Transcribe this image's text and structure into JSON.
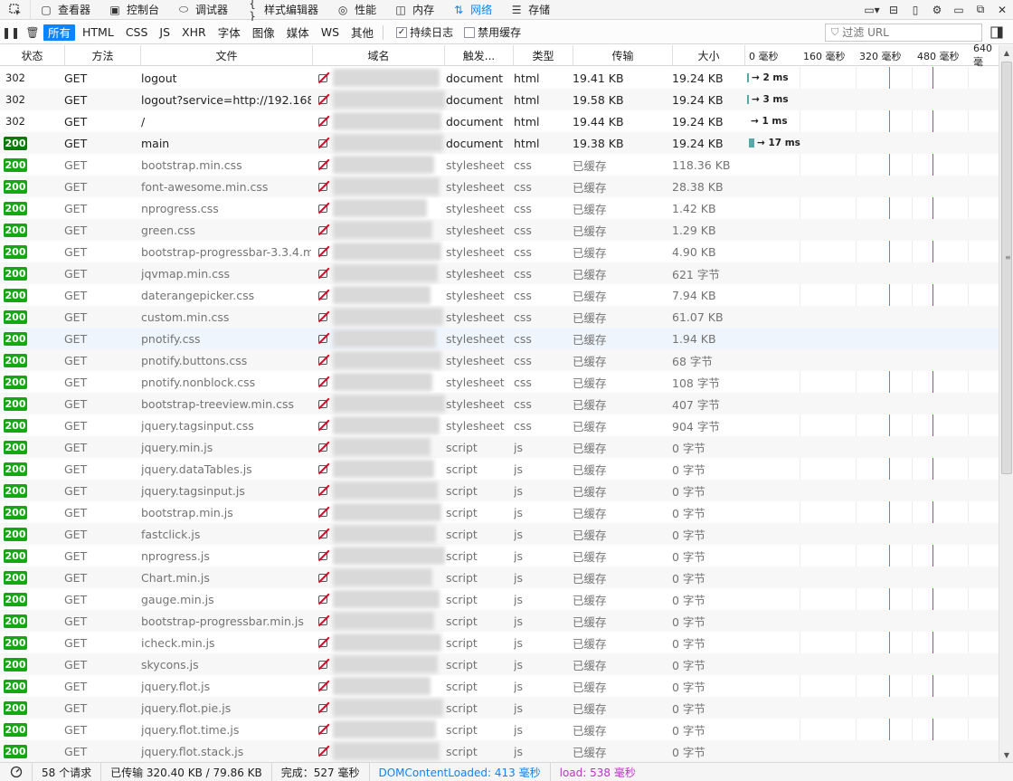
{
  "toolbar": {
    "tabs": [
      {
        "icon": "inspector-icon",
        "glyph": "▢",
        "label": "查看器"
      },
      {
        "icon": "console-icon",
        "glyph": "▣",
        "label": "控制台"
      },
      {
        "icon": "debugger-icon",
        "glyph": "⬭",
        "label": "调试器"
      },
      {
        "icon": "style-editor-icon",
        "glyph": "{ }",
        "label": "样式编辑器"
      },
      {
        "icon": "performance-icon",
        "glyph": "◎",
        "label": "性能"
      },
      {
        "icon": "memory-icon",
        "glyph": "◫",
        "label": "内存"
      },
      {
        "icon": "network-icon",
        "glyph": "⇅",
        "label": "网络"
      },
      {
        "icon": "storage-icon",
        "glyph": "☰",
        "label": "存储"
      }
    ],
    "active_tab": "网络"
  },
  "filters": {
    "types": [
      "所有",
      "HTML",
      "CSS",
      "JS",
      "XHR",
      "字体",
      "图像",
      "媒体",
      "WS",
      "其他"
    ],
    "active_type": "所有",
    "persist_logs_label": "持续日志",
    "persist_logs_checked": true,
    "disable_cache_label": "禁用缓存",
    "disable_cache_checked": false,
    "url_filter_placeholder": "过滤 URL"
  },
  "columns": {
    "status": "状态",
    "method": "方法",
    "file": "文件",
    "domain": "域名",
    "cause": "触发...",
    "type": "类型",
    "transferred": "传输",
    "size": "大小",
    "waterfall_ticks": [
      "0 毫秒",
      "160 毫秒",
      "320 毫秒",
      "480 毫秒",
      "640 毫"
    ]
  },
  "requests": [
    {
      "status": "302",
      "method": "GET",
      "file": "logout",
      "cause": "document",
      "type": "html",
      "transferred": "19.41 KB",
      "size": "19.24 KB",
      "timing": "→ 2 ms",
      "cached": false
    },
    {
      "status": "302",
      "method": "GET",
      "file": "logout?service=http://192.168....",
      "cause": "document",
      "type": "html",
      "transferred": "19.58 KB",
      "size": "19.24 KB",
      "timing": "→ 3 ms",
      "cached": false
    },
    {
      "status": "302",
      "method": "GET",
      "file": "/",
      "cause": "document",
      "type": "html",
      "transferred": "19.44 KB",
      "size": "19.24 KB",
      "timing": "→ 1 ms",
      "cached": false
    },
    {
      "status": "200",
      "method": "GET",
      "file": "main",
      "cause": "document",
      "type": "html",
      "transferred": "19.38 KB",
      "size": "19.24 KB",
      "timing": "→ 17 ms",
      "cached": false
    },
    {
      "status": "200",
      "method": "GET",
      "file": "bootstrap.min.css",
      "cause": "stylesheet",
      "type": "css",
      "transferred": "已缓存",
      "size": "118.36 KB",
      "cached": true
    },
    {
      "status": "200",
      "method": "GET",
      "file": "font-awesome.min.css",
      "cause": "stylesheet",
      "type": "css",
      "transferred": "已缓存",
      "size": "28.38 KB",
      "cached": true
    },
    {
      "status": "200",
      "method": "GET",
      "file": "nprogress.css",
      "cause": "stylesheet",
      "type": "css",
      "transferred": "已缓存",
      "size": "1.42 KB",
      "cached": true
    },
    {
      "status": "200",
      "method": "GET",
      "file": "green.css",
      "cause": "stylesheet",
      "type": "css",
      "transferred": "已缓存",
      "size": "1.29 KB",
      "cached": true
    },
    {
      "status": "200",
      "method": "GET",
      "file": "bootstrap-progressbar-3.3.4.m...",
      "cause": "stylesheet",
      "type": "css",
      "transferred": "已缓存",
      "size": "4.90 KB",
      "cached": true
    },
    {
      "status": "200",
      "method": "GET",
      "file": "jqvmap.min.css",
      "cause": "stylesheet",
      "type": "css",
      "transferred": "已缓存",
      "size": "621 字节",
      "cached": true
    },
    {
      "status": "200",
      "method": "GET",
      "file": "daterangepicker.css",
      "cause": "stylesheet",
      "type": "css",
      "transferred": "已缓存",
      "size": "7.94 KB",
      "cached": true
    },
    {
      "status": "200",
      "method": "GET",
      "file": "custom.min.css",
      "cause": "stylesheet",
      "type": "css",
      "transferred": "已缓存",
      "size": "61.07 KB",
      "cached": true
    },
    {
      "status": "200",
      "method": "GET",
      "file": "pnotify.css",
      "cause": "stylesheet",
      "type": "css",
      "transferred": "已缓存",
      "size": "1.94 KB",
      "cached": true
    },
    {
      "status": "200",
      "method": "GET",
      "file": "pnotify.buttons.css",
      "cause": "stylesheet",
      "type": "css",
      "transferred": "已缓存",
      "size": "68 字节",
      "cached": true
    },
    {
      "status": "200",
      "method": "GET",
      "file": "pnotify.nonblock.css",
      "cause": "stylesheet",
      "type": "css",
      "transferred": "已缓存",
      "size": "108 字节",
      "cached": true
    },
    {
      "status": "200",
      "method": "GET",
      "file": "bootstrap-treeview.min.css",
      "cause": "stylesheet",
      "type": "css",
      "transferred": "已缓存",
      "size": "407 字节",
      "cached": true
    },
    {
      "status": "200",
      "method": "GET",
      "file": "jquery.tagsinput.css",
      "cause": "stylesheet",
      "type": "css",
      "transferred": "已缓存",
      "size": "904 字节",
      "cached": true
    },
    {
      "status": "200",
      "method": "GET",
      "file": "jquery.min.js",
      "cause": "script",
      "type": "js",
      "transferred": "已缓存",
      "size": "0 字节",
      "cached": true
    },
    {
      "status": "200",
      "method": "GET",
      "file": "jquery.dataTables.js",
      "cause": "script",
      "type": "js",
      "transferred": "已缓存",
      "size": "0 字节",
      "cached": true
    },
    {
      "status": "200",
      "method": "GET",
      "file": "jquery.tagsinput.js",
      "cause": "script",
      "type": "js",
      "transferred": "已缓存",
      "size": "0 字节",
      "cached": true
    },
    {
      "status": "200",
      "method": "GET",
      "file": "bootstrap.min.js",
      "cause": "script",
      "type": "js",
      "transferred": "已缓存",
      "size": "0 字节",
      "cached": true
    },
    {
      "status": "200",
      "method": "GET",
      "file": "fastclick.js",
      "cause": "script",
      "type": "js",
      "transferred": "已缓存",
      "size": "0 字节",
      "cached": true
    },
    {
      "status": "200",
      "method": "GET",
      "file": "nprogress.js",
      "cause": "script",
      "type": "js",
      "transferred": "已缓存",
      "size": "0 字节",
      "cached": true
    },
    {
      "status": "200",
      "method": "GET",
      "file": "Chart.min.js",
      "cause": "script",
      "type": "js",
      "transferred": "已缓存",
      "size": "0 字节",
      "cached": true
    },
    {
      "status": "200",
      "method": "GET",
      "file": "gauge.min.js",
      "cause": "script",
      "type": "js",
      "transferred": "已缓存",
      "size": "0 字节",
      "cached": true
    },
    {
      "status": "200",
      "method": "GET",
      "file": "bootstrap-progressbar.min.js",
      "cause": "script",
      "type": "js",
      "transferred": "已缓存",
      "size": "0 字节",
      "cached": true
    },
    {
      "status": "200",
      "method": "GET",
      "file": "icheck.min.js",
      "cause": "script",
      "type": "js",
      "transferred": "已缓存",
      "size": "0 字节",
      "cached": true
    },
    {
      "status": "200",
      "method": "GET",
      "file": "skycons.js",
      "cause": "script",
      "type": "js",
      "transferred": "已缓存",
      "size": "0 字节",
      "cached": true
    },
    {
      "status": "200",
      "method": "GET",
      "file": "jquery.flot.js",
      "cause": "script",
      "type": "js",
      "transferred": "已缓存",
      "size": "0 字节",
      "cached": true
    },
    {
      "status": "200",
      "method": "GET",
      "file": "jquery.flot.pie.js",
      "cause": "script",
      "type": "js",
      "transferred": "已缓存",
      "size": "0 字节",
      "cached": true
    },
    {
      "status": "200",
      "method": "GET",
      "file": "jquery.flot.time.js",
      "cause": "script",
      "type": "js",
      "transferred": "已缓存",
      "size": "0 字节",
      "cached": true
    },
    {
      "status": "200",
      "method": "GET",
      "file": "jquery.flot.stack.js",
      "cause": "script",
      "type": "js",
      "transferred": "已缓存",
      "size": "0 字节",
      "cached": true
    }
  ],
  "footer": {
    "request_count": "58 个请求",
    "transferred": "已传输 320.40 KB / 79.86 KB",
    "finish": "完成：527 毫秒",
    "dom_content_loaded": "DOMContentLoaded: 413 毫秒",
    "load": "load: 538 毫秒"
  },
  "colors": {
    "accent": "#0a84ff",
    "status_ok": "#18a616",
    "load_marker": "#c032c8",
    "dom_marker": "#4d8fd8"
  }
}
